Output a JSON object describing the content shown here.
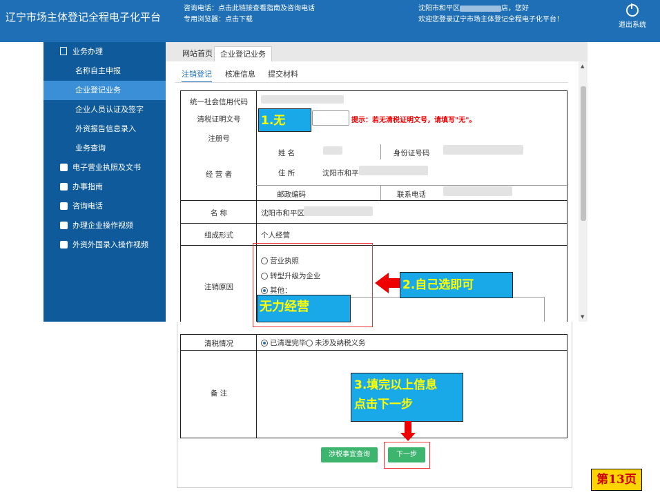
{
  "header": {
    "site_title": "辽宁市场主体登记全程电子化平台",
    "hotline": "咨询电话：点击此链接查看指南及咨询电话",
    "browser": "专用浏览器：点击下载",
    "welcome_1": "沈阳市和平区",
    "welcome_1_tail": "店，您好",
    "welcome_2": "欢迎您登录辽宁市场主体登记全程电子化平台！",
    "logout": "退出系统"
  },
  "sidebar": {
    "items": [
      {
        "label": "业务办理",
        "icon": "edit-doc-icon"
      },
      {
        "label": "名称自主申报"
      },
      {
        "label": "企业登记业务"
      },
      {
        "label": "企业人员认证及签字"
      },
      {
        "label": "外资报告信息录入"
      },
      {
        "label": "业务查询"
      },
      {
        "label": "电子营业执照及文书",
        "icon": "printer-icon"
      },
      {
        "label": "办事指南",
        "icon": "chat-icon"
      },
      {
        "label": "咨询电话",
        "icon": "chat-icon"
      },
      {
        "label": "办理企业操作视频",
        "icon": "check-icon"
      },
      {
        "label": "外资外国录入操作视频",
        "icon": "check-icon"
      }
    ]
  },
  "tabs": {
    "outer": [
      "网站首页",
      "企业登记业务"
    ],
    "inner": [
      "注销登记",
      "核准信息",
      "提交材料"
    ]
  },
  "form": {
    "credit_code_label": "统一社会信用代码",
    "clearance_label": "清税证明文号",
    "reg_no_label": "注册号",
    "hint": "提示：若无清税证明文号，请填写\"无\"。",
    "operator_label": "经 营 者",
    "name_label": "姓 名",
    "id_label": "身份证号码",
    "address_label": "住 所",
    "address_value": "沈阳市和平",
    "postal_label": "邮政编码",
    "phone_label": "联系电话",
    "shop_label": "名 称",
    "shop_value": "沈阳市和平区",
    "org_label": "组成形式",
    "org_value": "个人经营",
    "reason_label": "注销原因",
    "reason_options": [
      "营业执照",
      "转型升级为企业",
      "其他："
    ],
    "tax_label": "清税情况",
    "tax_options": [
      "已清理完毕",
      "未涉及纳税义务"
    ],
    "remark_label": "备 注"
  },
  "buttons": {
    "query": "涉税事宜查询",
    "next": "下一步"
  },
  "annotations": {
    "step1": "1.无",
    "step2": "2.自己选即可",
    "reason_text": "无力经营",
    "step3_line1": "3.填完以上信息",
    "step3_line2": "点击下一步",
    "page": "第13页"
  },
  "colors": {
    "header": "#1e6fb5",
    "sidebar": "#0e5a9a",
    "sidebar_active": "#3a8fd6",
    "callout": "#1aa9e8",
    "button": "#3db56f",
    "hint": "#e00000"
  }
}
